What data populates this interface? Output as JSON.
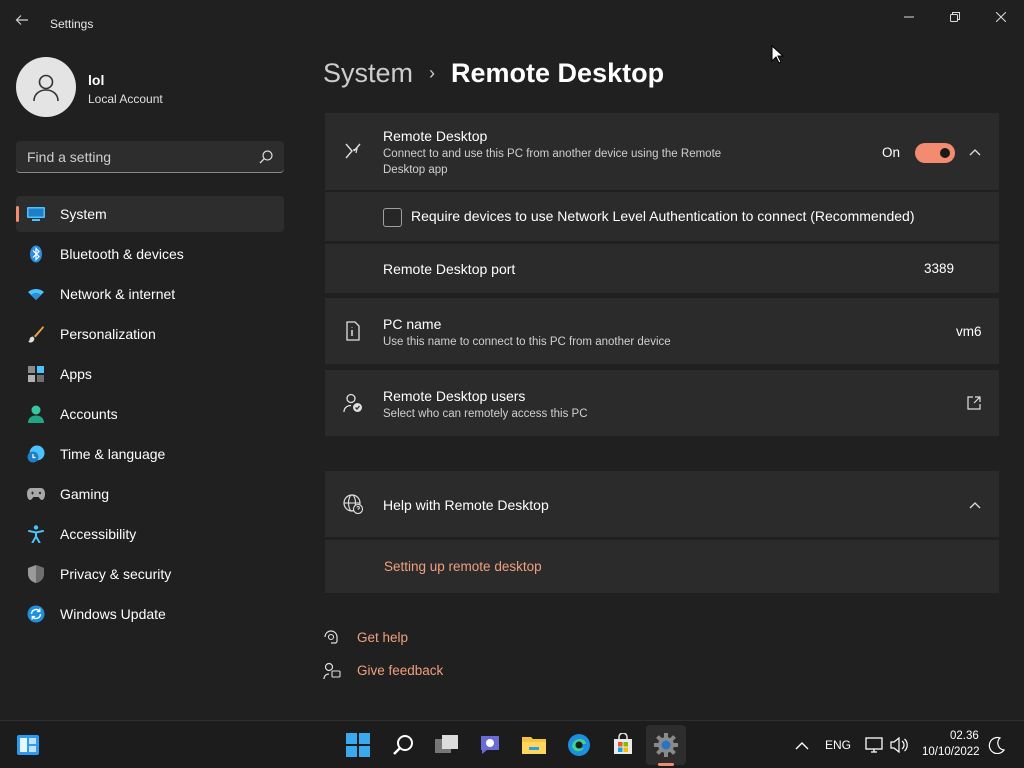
{
  "window": {
    "app_title": "Settings",
    "back_icon": "back-arrow-icon",
    "controls": [
      "minimize",
      "maximize",
      "close"
    ]
  },
  "user": {
    "name": "lol",
    "account_type": "Local Account"
  },
  "search": {
    "placeholder": "Find a setting"
  },
  "sidebar": {
    "items": [
      {
        "label": "System",
        "icon": "system-icon",
        "selected": true
      },
      {
        "label": "Bluetooth & devices",
        "icon": "bluetooth-icon"
      },
      {
        "label": "Network & internet",
        "icon": "wifi-icon"
      },
      {
        "label": "Personalization",
        "icon": "brush-icon"
      },
      {
        "label": "Apps",
        "icon": "apps-icon"
      },
      {
        "label": "Accounts",
        "icon": "accounts-icon"
      },
      {
        "label": "Time & language",
        "icon": "time-language-icon"
      },
      {
        "label": "Gaming",
        "icon": "gamepad-icon"
      },
      {
        "label": "Accessibility",
        "icon": "accessibility-icon"
      },
      {
        "label": "Privacy & security",
        "icon": "shield-icon"
      },
      {
        "label": "Windows Update",
        "icon": "windows-update-icon"
      }
    ]
  },
  "header": {
    "parent": "System",
    "separator": "›",
    "current": "Remote Desktop"
  },
  "remote_desktop": {
    "title": "Remote Desktop",
    "description": "Connect to and use this PC from another device using the Remote Desktop app",
    "toggle_label": "On",
    "toggle_on": true,
    "nla_label": "Require devices to use Network Level Authentication to connect (Recommended)",
    "nla_checked": false,
    "port_label": "Remote Desktop port",
    "port_value": "3389"
  },
  "pc_name": {
    "title": "PC name",
    "description": "Use this name to connect to this PC from another device",
    "value": "vm6"
  },
  "rd_users": {
    "title": "Remote Desktop users",
    "description": "Select who can remotely access this PC"
  },
  "help": {
    "title": "Help with Remote Desktop",
    "link": "Setting up remote desktop"
  },
  "footer_links": {
    "get_help": "Get help",
    "give_feedback": "Give feedback"
  },
  "taskbar": {
    "apps": [
      "start-icon",
      "search-icon",
      "task-view-icon",
      "chat-icon",
      "file-explorer-icon",
      "edge-icon",
      "store-icon",
      "settings-icon"
    ],
    "language": "ENG",
    "time": "02.36",
    "date": "10/10/2022"
  },
  "colors": {
    "accent": "#f28b6f",
    "link": "#f0a07f",
    "background": "#202020",
    "card": "#2b2b2b"
  }
}
